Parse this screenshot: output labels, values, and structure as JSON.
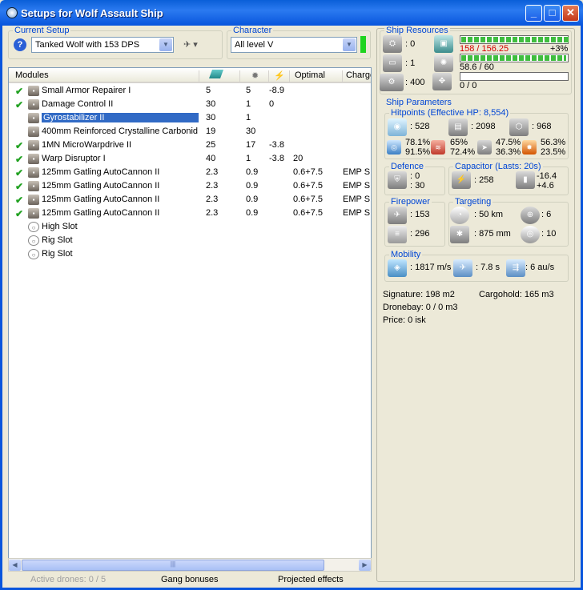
{
  "window": {
    "title": "Setups for Wolf Assault Ship",
    "min": "_",
    "max": "□",
    "close": "✕"
  },
  "setup": {
    "label": "Current Setup",
    "value": "Tanked Wolf with 153 DPS"
  },
  "character": {
    "label": "Character",
    "value": "All level V"
  },
  "modules": {
    "headers": [
      "Modules",
      "",
      "",
      "",
      "Optimal",
      "Charge"
    ],
    "rows": [
      {
        "checked": true,
        "icon": "armor-repairer-icon",
        "name": "Small Armor Repairer I",
        "c1": "5",
        "c2": "5",
        "c3": "-8.9",
        "optimal": "",
        "charge": ""
      },
      {
        "checked": true,
        "icon": "damage-control-icon",
        "name": "Damage Control II",
        "c1": "30",
        "c2": "1",
        "c3": "0",
        "optimal": "",
        "charge": ""
      },
      {
        "checked": false,
        "icon": "gyrostabilizer-icon",
        "name": "Gyrostabilizer II",
        "c1": "30",
        "c2": "1",
        "c3": "",
        "optimal": "",
        "charge": "",
        "selected": true
      },
      {
        "checked": false,
        "icon": "armor-plate-icon",
        "name": "400mm Reinforced Crystalline Carbonid...",
        "c1": "19",
        "c2": "30",
        "c3": "",
        "optimal": "",
        "charge": ""
      },
      {
        "checked": true,
        "icon": "microwarpdrive-icon",
        "name": "1MN MicroWarpdrive II",
        "c1": "25",
        "c2": "17",
        "c3": "-3.8",
        "optimal": "",
        "charge": ""
      },
      {
        "checked": true,
        "icon": "warp-disruptor-icon",
        "name": "Warp Disruptor I",
        "c1": "40",
        "c2": "1",
        "c3": "-3.8",
        "optimal": "20",
        "charge": ""
      },
      {
        "checked": true,
        "icon": "autocannon-icon",
        "name": "125mm Gatling AutoCannon II",
        "c1": "2.3",
        "c2": "0.9",
        "c3": "",
        "optimal": "0.6+7.5",
        "charge": "EMP S"
      },
      {
        "checked": true,
        "icon": "autocannon-icon",
        "name": "125mm Gatling AutoCannon II",
        "c1": "2.3",
        "c2": "0.9",
        "c3": "",
        "optimal": "0.6+7.5",
        "charge": "EMP S"
      },
      {
        "checked": true,
        "icon": "autocannon-icon",
        "name": "125mm Gatling AutoCannon II",
        "c1": "2.3",
        "c2": "0.9",
        "c3": "",
        "optimal": "0.6+7.5",
        "charge": "EMP S"
      },
      {
        "checked": true,
        "icon": "autocannon-icon",
        "name": "125mm Gatling AutoCannon II",
        "c1": "2.3",
        "c2": "0.9",
        "c3": "",
        "optimal": "0.6+7.5",
        "charge": "EMP S"
      },
      {
        "checked": false,
        "icon": "high-slot-icon",
        "name": "High Slot",
        "c1": "",
        "c2": "",
        "c3": "",
        "optimal": "",
        "charge": "",
        "empty": true
      },
      {
        "checked": false,
        "icon": "rig-slot-icon",
        "name": "Rig Slot",
        "c1": "",
        "c2": "",
        "c3": "",
        "optimal": "",
        "charge": "",
        "empty": true
      },
      {
        "checked": false,
        "icon": "rig-slot-icon",
        "name": "Rig Slot",
        "c1": "",
        "c2": "",
        "c3": "",
        "optimal": "",
        "charge": "",
        "empty": true
      }
    ]
  },
  "bottom_tabs": {
    "drones": "Active drones: 0 / 5",
    "gang": "Gang bonuses",
    "projected": "Projected effects"
  },
  "resources": {
    "label": "Ship Resources",
    "turrets": ": 0",
    "launchers": ": 1",
    "drone_bay": ": 400",
    "cpu_text": "158 / 156.25",
    "cpu_bonus": "+3%",
    "cpu_fraction": 1.0,
    "power_text": "58.6 / 60",
    "power_fraction": 0.977,
    "calib_text": "0 / 0",
    "calib_fraction": 0.0
  },
  "params": {
    "label": "Ship Parameters",
    "hp_label": "Hitpoints (Effective HP: 8,554)",
    "shield_hp": ": 528",
    "armor_hp": ": 2098",
    "hull_hp": ": 968",
    "res1": "78.1%",
    "res2": "91.5%",
    "res3": "65%",
    "res4": "72.4%",
    "res5": "47.5%",
    "res6": "36.3%",
    "res7": "56.3%",
    "res8": "23.5%",
    "defence_label": "Defence",
    "def1": ": 0",
    "def2": ": 30",
    "cap_label": "Capacitor (Lasts: 20s)",
    "cap_val": ": 258",
    "cap_use": "-16.4",
    "cap_regen": "+4.6",
    "fire_label": "Firepower",
    "dps": ": 153",
    "volley": ": 296",
    "tgt_label": "Targeting",
    "range": ": 50 km",
    "max_targets": ": 6",
    "scan_res": ": 875 mm",
    "sensor": ": 10",
    "mob_label": "Mobility",
    "speed": ": 1817 m/s",
    "align": ": 7.8 s",
    "warp": ": 6 au/s",
    "signature": "Signature: 198 m2",
    "cargohold": "Cargohold: 165 m3",
    "dronebay": "Dronebay: 0 / 0 m3",
    "price": "Price: 0 isk"
  },
  "colors": {
    "titlebar": "#0855dd",
    "accent_label": "#0046d5",
    "check": "#21a121",
    "over": "#d40000",
    "bar_fill": "#3fbd3f"
  }
}
